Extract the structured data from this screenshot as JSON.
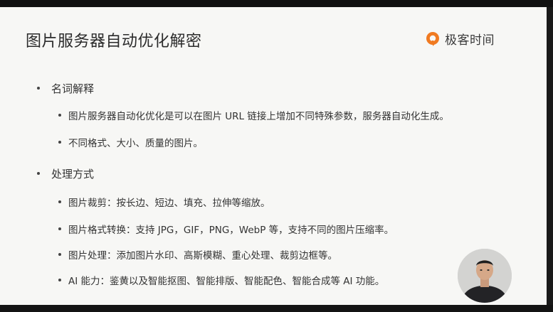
{
  "slide": {
    "title": "图片服务器自动优化解密",
    "brand": "极客时间",
    "sections": [
      {
        "heading": "名词解释",
        "items": [
          "图片服务器自动化优化是可以在图片 URL 链接上增加不同特殊参数，服务器自动化生成。",
          "不同格式、大小、质量的图片。"
        ]
      },
      {
        "heading": "处理方式",
        "items": [
          "图片裁剪：按长边、短边、填充、拉伸等缩放。",
          "图片格式转换：支持 JPG，GIF，PNG，WebP 等，支持不同的图片压缩率。",
          "图片处理：添加图片水印、高斯模糊、重心处理、裁剪边框等。",
          "AI 能力：鉴黄以及智能抠图、智能排版、智能配色、智能合成等 AI 功能。"
        ]
      }
    ]
  },
  "colors": {
    "slide_bg": "#f7f7f5",
    "brand_orange": "#f07a21",
    "text": "#333333"
  },
  "icons": {
    "logo": "geektime-logo-icon",
    "bullet": "bullet-dot-icon"
  }
}
